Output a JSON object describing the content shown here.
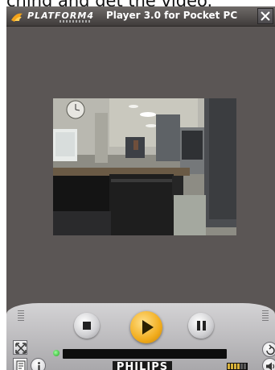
{
  "top_caption": "ching and get the video.",
  "titlebar": {
    "brand_name": "PLATFORM4",
    "title": "Player 3.0 for Pocket PC",
    "close_icon": "close-x-icon"
  },
  "video": {
    "scene": "office-webcam-frame"
  },
  "controls": {
    "stop_icon": "stop-icon",
    "play_icon": "play-icon",
    "pause_icon": "pause-icon",
    "progress_fraction": 0.0,
    "brand_label": "PHILIPS",
    "fullscreen_icon": "fullscreen-icon",
    "playlist_icon": "playlist-icon",
    "info_icon": "info-icon",
    "repeat_icon": "repeat-icon",
    "volume_icon": "speaker-icon",
    "volume_level_fraction": 0.6
  },
  "colors": {
    "frame": "#5b5655",
    "play_accent": "#f2ad1e",
    "status_led": "#1fa51f",
    "volume_on": "#d8b23a",
    "volume_off": "#5a5a5a"
  }
}
